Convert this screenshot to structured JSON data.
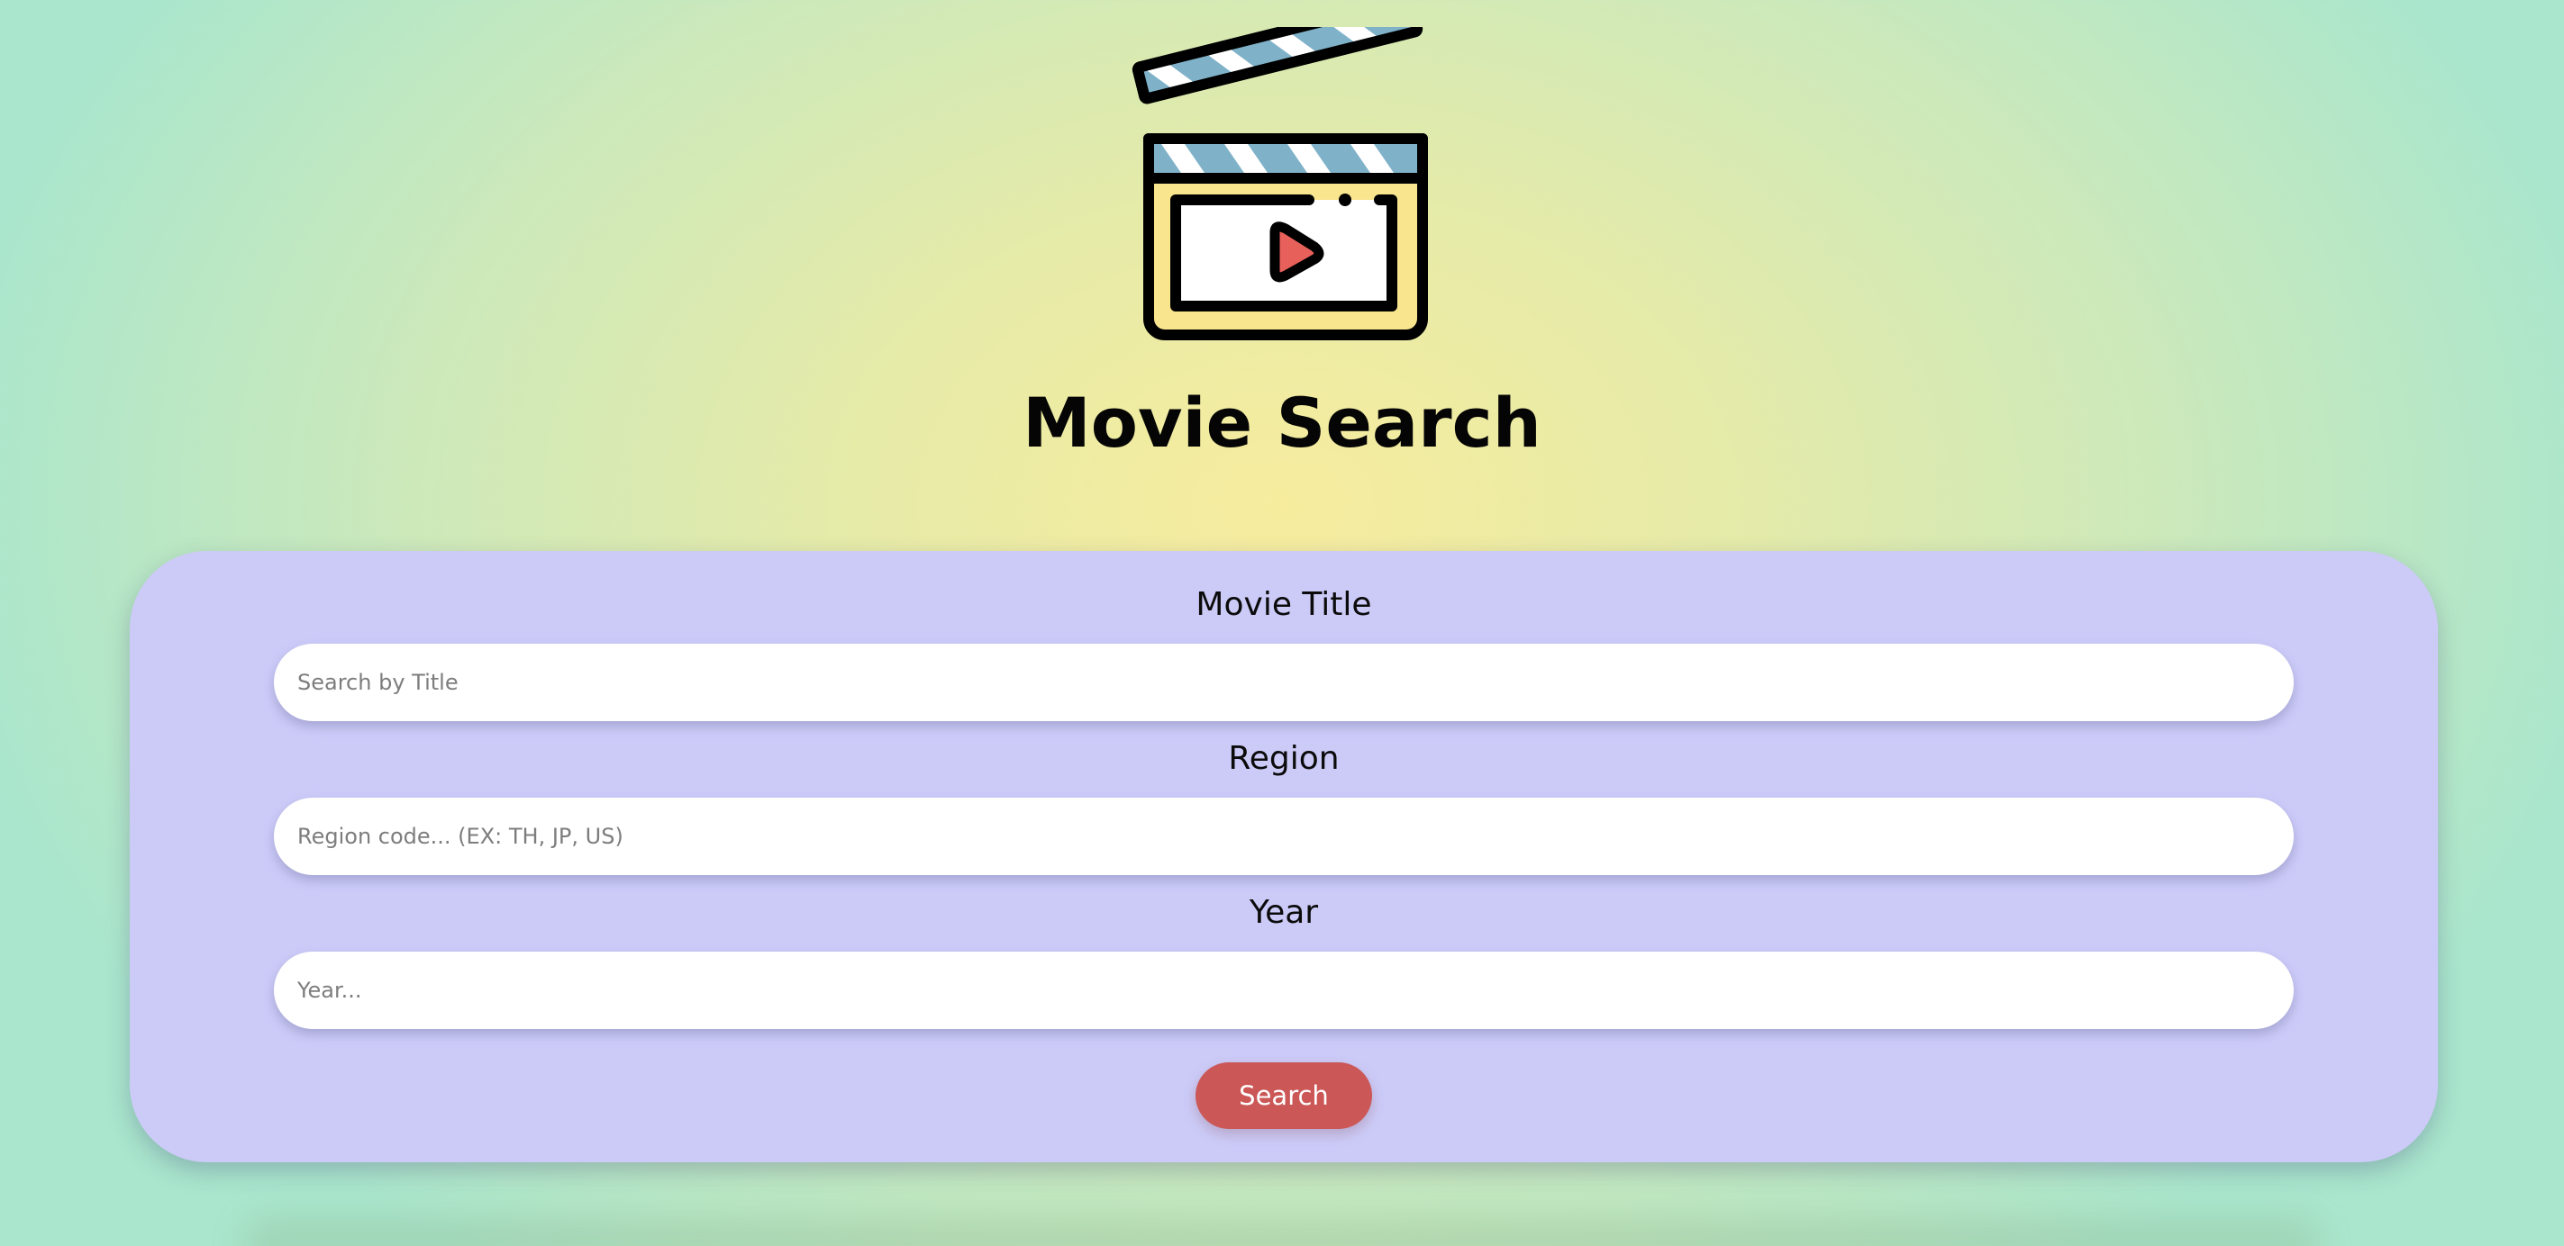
{
  "header": {
    "title": "Movie Search",
    "logo_icon": "clapperboard-icon"
  },
  "search_form": {
    "title_label": "Movie Title",
    "title_placeholder": "Search by Title",
    "title_value": "",
    "region_label": "Region",
    "region_placeholder": "Region code... (EX: TH, JP, US)",
    "region_value": "",
    "year_label": "Year",
    "year_placeholder": "Year...",
    "year_value": "",
    "search_button_label": "Search"
  },
  "colors": {
    "card_background": "#cccbf8",
    "button_background": "#cb5757",
    "clapper_stripe": "#7fb2c9",
    "clapper_body": "#f8e58e",
    "play_triangle": "#e8605a"
  }
}
